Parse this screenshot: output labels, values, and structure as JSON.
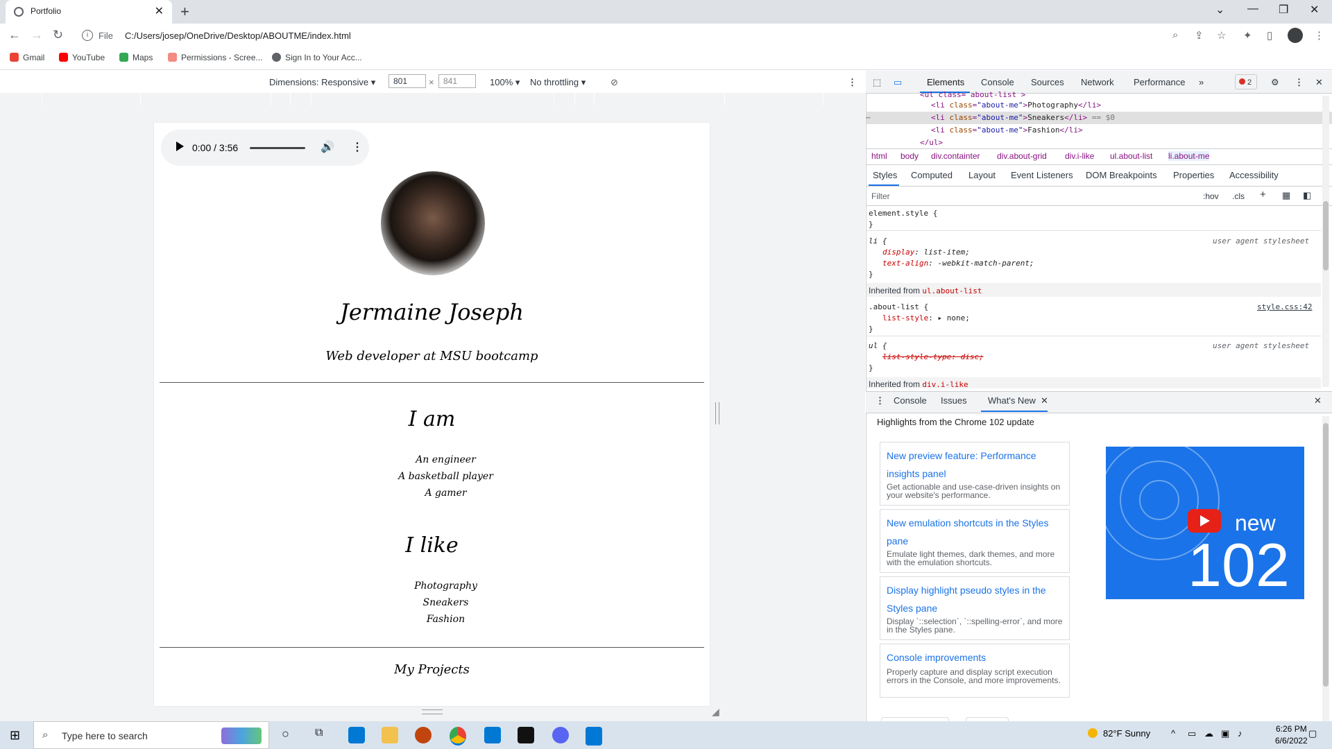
{
  "browser": {
    "tab_title": "Portfolio",
    "new_tab": "+",
    "address_scheme": "File",
    "address_url": "C:/Users/josep/OneDrive/Desktop/ABOUTME/index.html",
    "bookmarks": [
      {
        "label": "Gmail",
        "color": "#ea4335"
      },
      {
        "label": "YouTube",
        "color": "#ff0000"
      },
      {
        "label": "Maps",
        "color": "#34a853"
      },
      {
        "label": "Permissions - Scree...",
        "color": "#f28b82"
      },
      {
        "label": "Sign In to Your Acc...",
        "color": "#5f6368"
      }
    ]
  },
  "device_toolbar": {
    "dimensions_label": "Dimensions: Responsive",
    "width": "801",
    "times": "×",
    "height": "841",
    "zoom": "100%",
    "throttling": "No throttling"
  },
  "page": {
    "audio": {
      "time": "0:00 / 3:56"
    },
    "name": "Jermaine Joseph",
    "subtitle": "Web developer at MSU bootcamp",
    "i_am_heading": "I am",
    "i_am_items": [
      "An engineer",
      "A basketball player",
      "A gamer"
    ],
    "i_like_heading": "I like",
    "i_like_items": [
      "Photography",
      "Sneakers",
      "Fashion"
    ],
    "projects_heading": "My Projects"
  },
  "devtools": {
    "tabs": [
      "Elements",
      "Console",
      "Sources",
      "Network",
      "Performance",
      "»"
    ],
    "error_count": "2",
    "dom_lines": {
      "top": "<ul class= about-list >",
      "li1_text": "Photography",
      "li2_text": "Sneakers",
      "li2_suffix": " == $0",
      "li3_text": "Fashion",
      "bottom": "</ul>",
      "class_attr": "class",
      "class_val": "\"about-me\""
    },
    "breadcrumbs": [
      "html",
      "body",
      "div.containter",
      "div.about-grid",
      "div.i-like",
      "ul.about-list",
      "li.about-me"
    ],
    "subtabs": [
      "Styles",
      "Computed",
      "Layout",
      "Event Listeners",
      "DOM Breakpoints",
      "Properties",
      "Accessibility"
    ],
    "filter_placeholder": "Filter",
    "filter_hov": ":hov",
    "filter_cls": ".cls",
    "styles": {
      "element_style": "element.style {",
      "close": "}",
      "li_selector": "li {",
      "li_src": "user agent stylesheet",
      "li_prop1": "display",
      "li_val1": "list-item;",
      "li_prop2": "text-align",
      "li_val2": "-webkit-match-parent;",
      "inherited1_label": "Inherited from",
      "inherited1_from": "ul.about-list",
      "aboutlist_selector": ".about-list {",
      "aboutlist_src": "style.css:42",
      "aboutlist_prop": "list-style",
      "aboutlist_val": "none;",
      "ul_selector": "ul {",
      "ul_src": "user agent stylesheet",
      "ul_struck": "list-style-type: disc;",
      "inherited2_from": "div.i-like"
    },
    "drawer_tabs": [
      "Console",
      "Issues",
      "What's New"
    ],
    "whats_new_header": "Highlights from the Chrome 102 update",
    "cards": [
      {
        "title": "New preview feature: Performance insights panel",
        "desc": "Get actionable and use-case-driven insights on your website's performance."
      },
      {
        "title": "New emulation shortcuts in the Styles pane",
        "desc": "Emulate light themes, dark themes, and more with the emulation shortcuts."
      },
      {
        "title": "Display highlight pseudo styles in the Styles pane",
        "desc": "Display `::selection`, `::spelling-error`, and more in the Styles pane."
      },
      {
        "title": "Console improvements",
        "desc": "Properly capture and display script execution errors in the Console, and more improvements."
      }
    ],
    "promo": {
      "new": "new",
      "version": "102"
    }
  },
  "taskbar": {
    "search_placeholder": "Type here to search",
    "weather": "82°F  Sunny",
    "time": "6:26 PM",
    "date": "6/6/2022"
  },
  "colors": {
    "accent": "#1a73e8",
    "taskbar": "#d9e3ee",
    "devtools_tag": "#881280"
  }
}
